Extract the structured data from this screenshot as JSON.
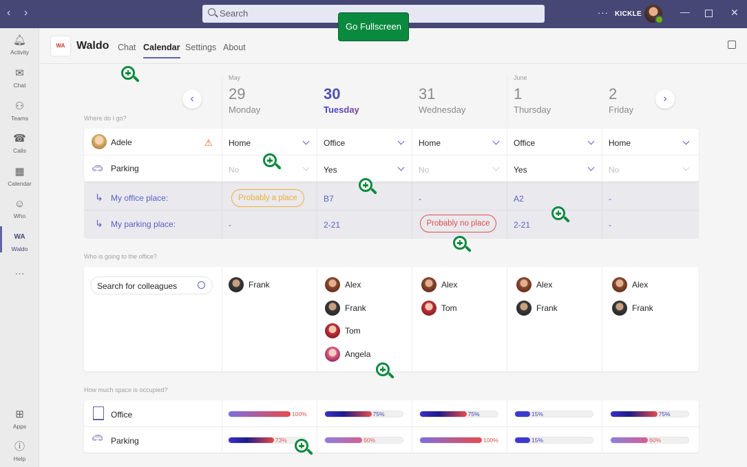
{
  "titlebar": {
    "search_placeholder": "Search",
    "user": "KICKLE",
    "more": "···",
    "fullscreen_button": "Go Fullscreen"
  },
  "rail": [
    {
      "label": "Activity",
      "icon": "bell-icon"
    },
    {
      "label": "Chat",
      "icon": "chat-icon"
    },
    {
      "label": "Teams",
      "icon": "teams-icon"
    },
    {
      "label": "Calls",
      "icon": "phone-icon"
    },
    {
      "label": "Calendar",
      "icon": "calendar-icon"
    },
    {
      "label": "Who",
      "icon": "who-icon"
    },
    {
      "label": "Waldo",
      "icon": "waldo-icon"
    },
    {
      "label": "Apps",
      "icon": "apps-icon"
    },
    {
      "label": "Help",
      "icon": "help-icon"
    }
  ],
  "app": {
    "name": "Waldo",
    "logo": "WA",
    "tabs": [
      "Chat",
      "Calendar",
      "Settings",
      "About"
    ],
    "active_tab": "Calendar"
  },
  "days": [
    {
      "month": "May",
      "num": "29",
      "name": "Monday"
    },
    {
      "month": "",
      "num": "30",
      "name": "Tuesday"
    },
    {
      "month": "",
      "num": "31",
      "name": "Wednesday"
    },
    {
      "month": "June",
      "num": "1",
      "name": "Thursday"
    },
    {
      "month": "",
      "num": "2",
      "name": "Friday"
    }
  ],
  "where": {
    "question": "Where do I go?",
    "user": "Adele",
    "parking_label": "Parking",
    "location": [
      "Home",
      "Office",
      "Home",
      "Office",
      "Home"
    ],
    "parking": [
      "No",
      "Yes",
      "No",
      "Yes",
      "No"
    ],
    "office_place_label": "My office place:",
    "parking_place_label": "My parking place:",
    "office_place": [
      "Probably a place",
      "B7",
      "-",
      "A2",
      "-"
    ],
    "parking_place": [
      "-",
      "2-21",
      "Probably no place",
      "2-21",
      "-"
    ]
  },
  "who": {
    "question": "Who is going to the office?",
    "search_placeholder": "Search for colleagues",
    "people": [
      [
        "Frank"
      ],
      [
        "Alex",
        "Frank",
        "Tom",
        "Angela"
      ],
      [
        "Alex",
        "Tom"
      ],
      [
        "Alex",
        "Frank"
      ],
      [
        "Alex",
        "Frank"
      ]
    ]
  },
  "space": {
    "question": "How much space is occupied?",
    "office_label": "Office",
    "parking_label": "Parking",
    "office": [
      100,
      75,
      75,
      15,
      75
    ],
    "parking": [
      73,
      60,
      100,
      15,
      60
    ],
    "office_text": [
      "100%",
      "75%",
      "75%",
      "15%",
      "75%"
    ],
    "parking_text": [
      "73%",
      "60%",
      "100%",
      "15%",
      "60%"
    ]
  },
  "colors": {
    "accent": "#6264a7",
    "titlebar": "#464775",
    "fullscreen": "#0a8a3e",
    "warn": "#e8590c",
    "amber": "#f0b034",
    "red": "#e0504a"
  }
}
